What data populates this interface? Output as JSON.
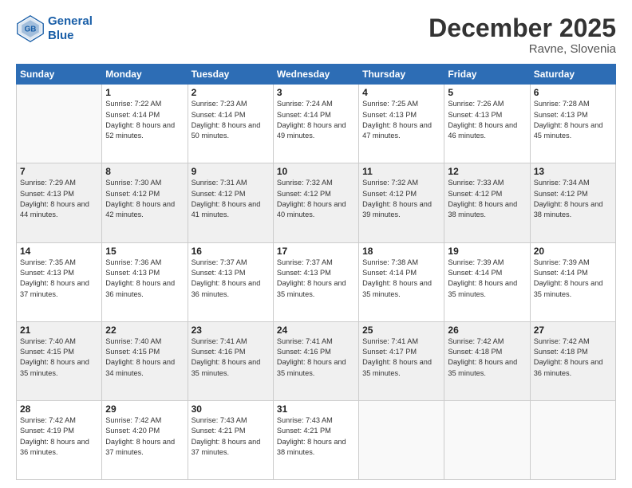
{
  "header": {
    "logo_line1": "General",
    "logo_line2": "Blue",
    "month_title": "December 2025",
    "location": "Ravne, Slovenia"
  },
  "weekdays": [
    "Sunday",
    "Monday",
    "Tuesday",
    "Wednesday",
    "Thursday",
    "Friday",
    "Saturday"
  ],
  "rows": [
    [
      {
        "day": "",
        "sunrise": "",
        "sunset": "",
        "daylight": ""
      },
      {
        "day": "1",
        "sunrise": "Sunrise: 7:22 AM",
        "sunset": "Sunset: 4:14 PM",
        "daylight": "Daylight: 8 hours and 52 minutes."
      },
      {
        "day": "2",
        "sunrise": "Sunrise: 7:23 AM",
        "sunset": "Sunset: 4:14 PM",
        "daylight": "Daylight: 8 hours and 50 minutes."
      },
      {
        "day": "3",
        "sunrise": "Sunrise: 7:24 AM",
        "sunset": "Sunset: 4:14 PM",
        "daylight": "Daylight: 8 hours and 49 minutes."
      },
      {
        "day": "4",
        "sunrise": "Sunrise: 7:25 AM",
        "sunset": "Sunset: 4:13 PM",
        "daylight": "Daylight: 8 hours and 47 minutes."
      },
      {
        "day": "5",
        "sunrise": "Sunrise: 7:26 AM",
        "sunset": "Sunset: 4:13 PM",
        "daylight": "Daylight: 8 hours and 46 minutes."
      },
      {
        "day": "6",
        "sunrise": "Sunrise: 7:28 AM",
        "sunset": "Sunset: 4:13 PM",
        "daylight": "Daylight: 8 hours and 45 minutes."
      }
    ],
    [
      {
        "day": "7",
        "sunrise": "Sunrise: 7:29 AM",
        "sunset": "Sunset: 4:13 PM",
        "daylight": "Daylight: 8 hours and 44 minutes."
      },
      {
        "day": "8",
        "sunrise": "Sunrise: 7:30 AM",
        "sunset": "Sunset: 4:12 PM",
        "daylight": "Daylight: 8 hours and 42 minutes."
      },
      {
        "day": "9",
        "sunrise": "Sunrise: 7:31 AM",
        "sunset": "Sunset: 4:12 PM",
        "daylight": "Daylight: 8 hours and 41 minutes."
      },
      {
        "day": "10",
        "sunrise": "Sunrise: 7:32 AM",
        "sunset": "Sunset: 4:12 PM",
        "daylight": "Daylight: 8 hours and 40 minutes."
      },
      {
        "day": "11",
        "sunrise": "Sunrise: 7:32 AM",
        "sunset": "Sunset: 4:12 PM",
        "daylight": "Daylight: 8 hours and 39 minutes."
      },
      {
        "day": "12",
        "sunrise": "Sunrise: 7:33 AM",
        "sunset": "Sunset: 4:12 PM",
        "daylight": "Daylight: 8 hours and 38 minutes."
      },
      {
        "day": "13",
        "sunrise": "Sunrise: 7:34 AM",
        "sunset": "Sunset: 4:12 PM",
        "daylight": "Daylight: 8 hours and 38 minutes."
      }
    ],
    [
      {
        "day": "14",
        "sunrise": "Sunrise: 7:35 AM",
        "sunset": "Sunset: 4:13 PM",
        "daylight": "Daylight: 8 hours and 37 minutes."
      },
      {
        "day": "15",
        "sunrise": "Sunrise: 7:36 AM",
        "sunset": "Sunset: 4:13 PM",
        "daylight": "Daylight: 8 hours and 36 minutes."
      },
      {
        "day": "16",
        "sunrise": "Sunrise: 7:37 AM",
        "sunset": "Sunset: 4:13 PM",
        "daylight": "Daylight: 8 hours and 36 minutes."
      },
      {
        "day": "17",
        "sunrise": "Sunrise: 7:37 AM",
        "sunset": "Sunset: 4:13 PM",
        "daylight": "Daylight: 8 hours and 35 minutes."
      },
      {
        "day": "18",
        "sunrise": "Sunrise: 7:38 AM",
        "sunset": "Sunset: 4:14 PM",
        "daylight": "Daylight: 8 hours and 35 minutes."
      },
      {
        "day": "19",
        "sunrise": "Sunrise: 7:39 AM",
        "sunset": "Sunset: 4:14 PM",
        "daylight": "Daylight: 8 hours and 35 minutes."
      },
      {
        "day": "20",
        "sunrise": "Sunrise: 7:39 AM",
        "sunset": "Sunset: 4:14 PM",
        "daylight": "Daylight: 8 hours and 35 minutes."
      }
    ],
    [
      {
        "day": "21",
        "sunrise": "Sunrise: 7:40 AM",
        "sunset": "Sunset: 4:15 PM",
        "daylight": "Daylight: 8 hours and 35 minutes."
      },
      {
        "day": "22",
        "sunrise": "Sunrise: 7:40 AM",
        "sunset": "Sunset: 4:15 PM",
        "daylight": "Daylight: 8 hours and 34 minutes."
      },
      {
        "day": "23",
        "sunrise": "Sunrise: 7:41 AM",
        "sunset": "Sunset: 4:16 PM",
        "daylight": "Daylight: 8 hours and 35 minutes."
      },
      {
        "day": "24",
        "sunrise": "Sunrise: 7:41 AM",
        "sunset": "Sunset: 4:16 PM",
        "daylight": "Daylight: 8 hours and 35 minutes."
      },
      {
        "day": "25",
        "sunrise": "Sunrise: 7:41 AM",
        "sunset": "Sunset: 4:17 PM",
        "daylight": "Daylight: 8 hours and 35 minutes."
      },
      {
        "day": "26",
        "sunrise": "Sunrise: 7:42 AM",
        "sunset": "Sunset: 4:18 PM",
        "daylight": "Daylight: 8 hours and 35 minutes."
      },
      {
        "day": "27",
        "sunrise": "Sunrise: 7:42 AM",
        "sunset": "Sunset: 4:18 PM",
        "daylight": "Daylight: 8 hours and 36 minutes."
      }
    ],
    [
      {
        "day": "28",
        "sunrise": "Sunrise: 7:42 AM",
        "sunset": "Sunset: 4:19 PM",
        "daylight": "Daylight: 8 hours and 36 minutes."
      },
      {
        "day": "29",
        "sunrise": "Sunrise: 7:42 AM",
        "sunset": "Sunset: 4:20 PM",
        "daylight": "Daylight: 8 hours and 37 minutes."
      },
      {
        "day": "30",
        "sunrise": "Sunrise: 7:43 AM",
        "sunset": "Sunset: 4:21 PM",
        "daylight": "Daylight: 8 hours and 37 minutes."
      },
      {
        "day": "31",
        "sunrise": "Sunrise: 7:43 AM",
        "sunset": "Sunset: 4:21 PM",
        "daylight": "Daylight: 8 hours and 38 minutes."
      },
      {
        "day": "",
        "sunrise": "",
        "sunset": "",
        "daylight": ""
      },
      {
        "day": "",
        "sunrise": "",
        "sunset": "",
        "daylight": ""
      },
      {
        "day": "",
        "sunrise": "",
        "sunset": "",
        "daylight": ""
      }
    ]
  ]
}
